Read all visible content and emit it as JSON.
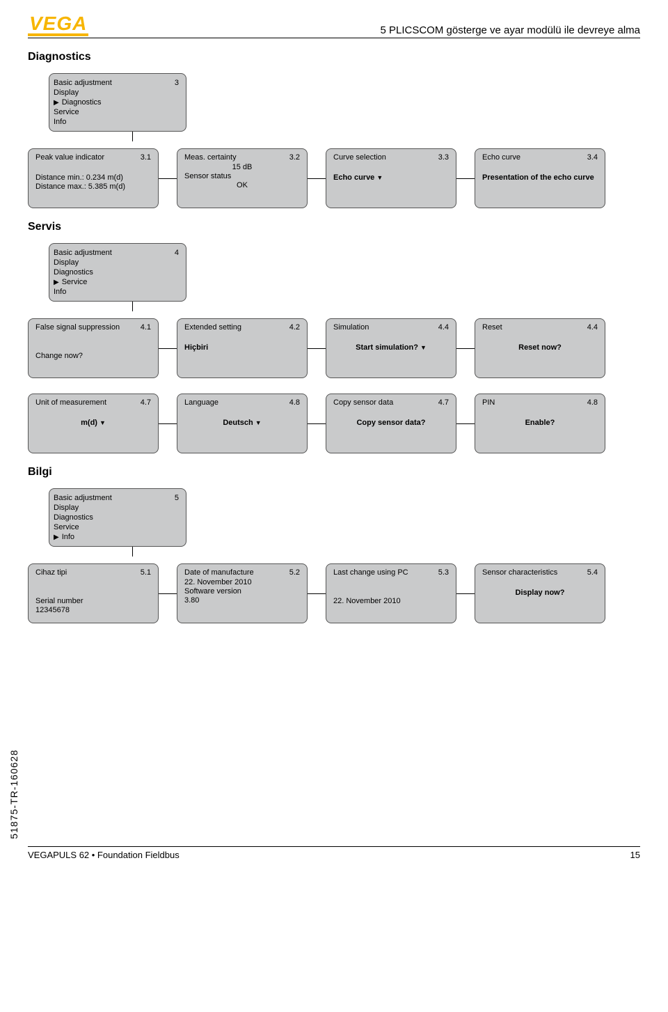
{
  "header": {
    "logo": "VEGA",
    "title": "5 PLICSCOM gösterge ve ayar modülü ile devreye alma"
  },
  "diagnostics": {
    "title": "Diagnostics",
    "menu": {
      "num": "3",
      "items": [
        "Basic adjustment",
        "Display",
        "Diagnostics",
        "Service",
        "Info"
      ],
      "selected": "Diagnostics"
    },
    "screens": [
      {
        "title": "Peak value indicator",
        "num": "3.1",
        "l1": "Distance min.: 0.234 m(d)",
        "l2": "Distance max.: 5.385 m(d)"
      },
      {
        "title": "Meas. certainty",
        "num": "3.2",
        "c1": "15 dB",
        "l1": "Sensor status",
        "c2": "OK"
      },
      {
        "title": "Curve selection",
        "num": "3.3",
        "b1": "Echo curve",
        "tri": true
      },
      {
        "title": "Echo curve",
        "num": "3.4",
        "b1": "Presentation of the echo curve"
      }
    ]
  },
  "servis": {
    "title": "Servis",
    "menu": {
      "num": "4",
      "items": [
        "Basic adjustment",
        "Display",
        "Diagnostics",
        "Service",
        "Info"
      ],
      "selected": "Service"
    },
    "row1": [
      {
        "title": "False signal suppression",
        "num": "4.1",
        "l1": "Change now?"
      },
      {
        "title": "Extended setting",
        "num": "4.2",
        "b1": "Hiçbiri"
      },
      {
        "title": "Simulation",
        "num": "4.4",
        "b1": "Start simulation?",
        "tri": true
      },
      {
        "title": "Reset",
        "num": "4.4",
        "b1": "Reset now?"
      }
    ],
    "row2": [
      {
        "title": "Unit of measurement",
        "num": "4.7",
        "b1": "m(d)",
        "tri": true,
        "center": true
      },
      {
        "title": "Language",
        "num": "4.8",
        "b1": "Deutsch",
        "tri": true,
        "center": true
      },
      {
        "title": "Copy sensor data",
        "num": "4.7",
        "b1": "Copy sensor data?",
        "center": true
      },
      {
        "title": "PIN",
        "num": "4.8",
        "b1": "Enable?",
        "center": true
      }
    ]
  },
  "bilgi": {
    "title": "Bilgi",
    "menu": {
      "num": "5",
      "items": [
        "Basic adjustment",
        "Display",
        "Diagnostics",
        "Service",
        "Info"
      ],
      "selected": "Info"
    },
    "screens": [
      {
        "title": "Cihaz tipi",
        "num": "5.1",
        "l1": "Serial number",
        "l2": "12345678"
      },
      {
        "title": "Date of manufacture",
        "num": "5.2",
        "l1": "22. November 2010",
        "l2": "Software version",
        "l3": "3.80"
      },
      {
        "title": "Last change using PC",
        "num": "5.3",
        "l1": "22. November 2010"
      },
      {
        "title": "Sensor characteristics",
        "num": "5.4",
        "b1": "Display now?"
      }
    ]
  },
  "sidecode": "51875-TR-160628",
  "footer": {
    "left": "VEGAPULS 62 • Foundation Fieldbus",
    "right": "15"
  }
}
